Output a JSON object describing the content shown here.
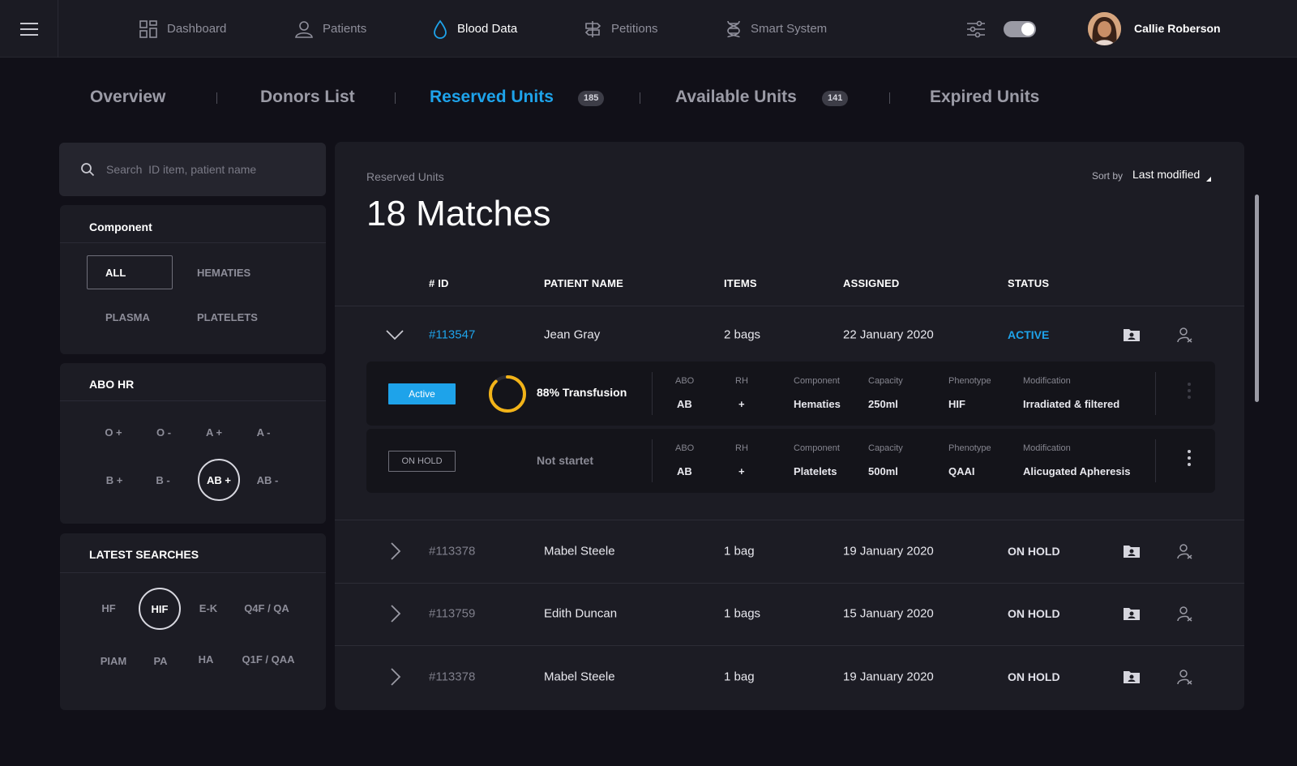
{
  "topbar": {
    "nav": [
      {
        "label": "Dashboard",
        "icon": "dashboard-icon"
      },
      {
        "label": "Patients",
        "icon": "user-icon"
      },
      {
        "label": "Blood Data",
        "icon": "drop-icon"
      },
      {
        "label": "Petitions",
        "icon": "signpost-icon"
      },
      {
        "label": "Smart System",
        "icon": "dna-icon"
      }
    ],
    "active_nav": "Blood Data",
    "toggle_on": true,
    "user_name": "Callie Roberson"
  },
  "tabs": {
    "overview": "Overview",
    "donors": "Donors List",
    "reserved": "Reserved Units",
    "reserved_count": "185",
    "available": "Available Units",
    "available_count": "141",
    "expired": "Expired Units"
  },
  "search": {
    "placeholder": "Search  ID item, patient name"
  },
  "component": {
    "title": "Component",
    "items": [
      "ALL",
      "HEMATIES",
      "PLASMA",
      "PLATELETS"
    ],
    "selected": "ALL"
  },
  "abo": {
    "title": "ABO HR",
    "items": [
      "O +",
      "O -",
      "A +",
      "A -",
      "B +",
      "B -",
      "AB +",
      "AB -"
    ],
    "selected": "AB +"
  },
  "latest": {
    "title": "LATEST SEARCHES",
    "items": [
      "HF",
      "HIF",
      "E-K",
      "Q4F / QA",
      "PIAM",
      "PA",
      "HA",
      "Q1F / QAA"
    ],
    "selected": "HIF"
  },
  "main": {
    "label": "Reserved Units",
    "matches": "18 Matches",
    "sort_label": "Sort by",
    "sort_value": "Last modified",
    "columns": {
      "id": "# ID",
      "patient": "PATIENT NAME",
      "items": "ITEMS",
      "assigned": "ASSIGNED",
      "status": "STATUS"
    },
    "rows": [
      {
        "id": "#113547",
        "patient": "Jean Gray",
        "items": "2 bags",
        "assigned": "22 January 2020",
        "status": "ACTIVE",
        "expanded": true
      },
      {
        "id": "#113378",
        "patient": "Mabel Steele",
        "items": "1 bag",
        "assigned": "19 January 2020",
        "status": "ON HOLD",
        "expanded": false
      },
      {
        "id": "#113759",
        "patient": "Edith Duncan",
        "items": "1 bags",
        "assigned": "15 January 2020",
        "status": "ON HOLD",
        "expanded": false
      },
      {
        "id": "#113378",
        "patient": "Mabel Steele",
        "items": "1 bag",
        "assigned": "19 January 2020",
        "status": "ON HOLD",
        "expanded": false
      }
    ],
    "units": [
      {
        "badge": "Active",
        "progress_percent": 88,
        "progress_label": "88% Transfusion",
        "labels": {
          "abo": "ABO",
          "rh": "RH",
          "component": "Component",
          "capacity": "Capacity",
          "phenotype": "Phenotype",
          "modification": "Modification"
        },
        "values": {
          "abo": "AB",
          "rh": "+",
          "component": "Hematies",
          "capacity": "250ml",
          "phenotype": "HIF",
          "modification": "Irradiated & filtered"
        }
      },
      {
        "badge": "ON HOLD",
        "progress_label": "Not startet",
        "labels": {
          "abo": "ABO",
          "rh": "RH",
          "component": "Component",
          "capacity": "Capacity",
          "phenotype": "Phenotype",
          "modification": "Modification"
        },
        "values": {
          "abo": "AB",
          "rh": "+",
          "component": "Platelets",
          "capacity": "500ml",
          "phenotype": "QAAI",
          "modification": "Alicugated Apheresis"
        }
      }
    ]
  },
  "colors": {
    "accent": "#1ea3ea",
    "progress": "#f2b318",
    "bg": "#111018",
    "panel": "#1c1c24"
  }
}
